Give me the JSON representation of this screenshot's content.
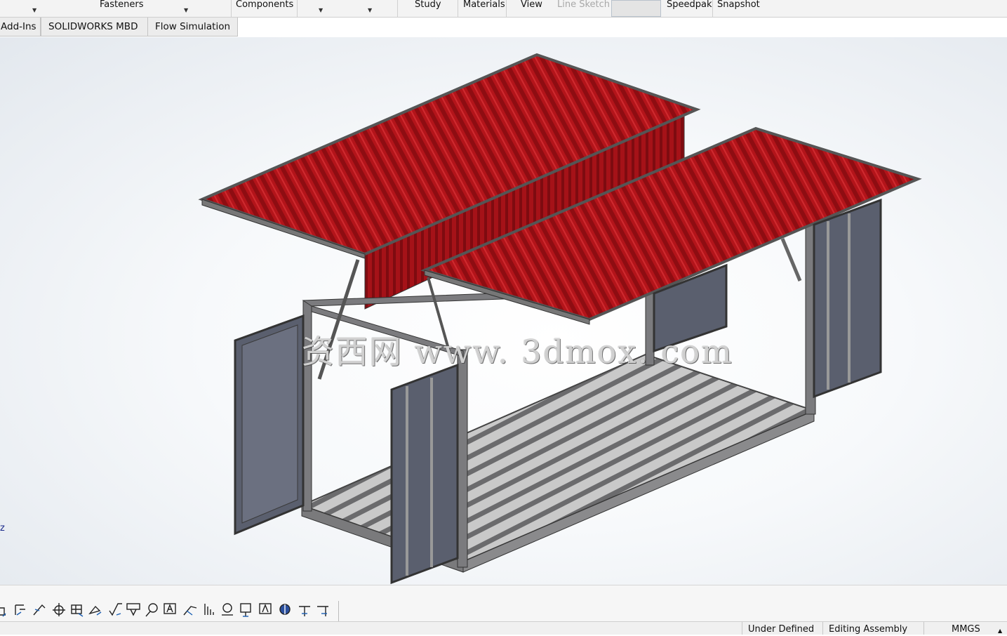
{
  "ribbon": {
    "fasteners": "Fasteners",
    "components": "Components",
    "study": "Study",
    "materials": "Materials",
    "view": "View",
    "line_sketch": "Line Sketch",
    "speedpak": "Speedpak",
    "snapshot": "Snapshot"
  },
  "tabs": {
    "addins": "Add-Ins",
    "mbd": "SOLIDWORKS MBD",
    "flow": "Flow Simulation"
  },
  "heads_up_icons": [
    "zoom-to-fit-icon",
    "zoom-to-area-icon",
    "previous-view-icon",
    "section-view-icon",
    "dynamic-annotation-icon",
    "view-orientation-icon",
    "display-style-icon",
    "hide-show-items-icon",
    "edit-appearance-icon",
    "apply-scene-icon",
    "view-settings-icon"
  ],
  "command_icons": [
    "smart-dimension-icon",
    "linear-pattern-icon",
    "sketch-icon",
    "datum-icon",
    "table-icon",
    "weld-icon",
    "surface-finish-icon",
    "note-balloon-icon",
    "auto-balloon-icon",
    "note-icon",
    "centerline-icon",
    "hatch-icon",
    "magnet-line-icon",
    "datum-target-icon",
    "block-icon",
    "appearance-icon",
    "leader-icon",
    "leader-2-icon"
  ],
  "triad_label": "z",
  "watermark": "资西网 www. 3dmox. com",
  "status": {
    "under_defined": "Under Defined",
    "editing": "Editing Assembly",
    "units": "MMGS"
  },
  "colors": {
    "roof_red": "#b3141a",
    "frame_gray": "#6f6f72",
    "door_blue": "#5a5f6e"
  }
}
